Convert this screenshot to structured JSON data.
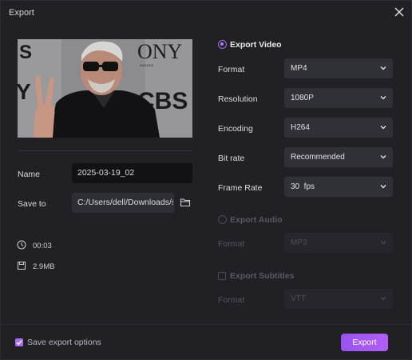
{
  "window": {
    "title": "Export"
  },
  "left": {
    "name_label": "Name",
    "name_value": "2025-03-19_02",
    "save_label": "Save to",
    "save_value": "C:/Users/dell/Downloads/sub",
    "duration": "00:03",
    "size": "2.9MB",
    "thumbnail_text": {
      "top_left": "S",
      "top_right": "ONY",
      "awards": "AWARDS",
      "right": "CBS",
      "left": "Y"
    }
  },
  "video": {
    "title": "Export Video",
    "selected": true,
    "rows": [
      {
        "label": "Format",
        "value": "MP4"
      },
      {
        "label": "Resolution",
        "value": "1080P"
      },
      {
        "label": "Encoding",
        "value": "H264"
      },
      {
        "label": "Bit rate",
        "value": "Recommended"
      },
      {
        "label": "Frame Rate",
        "value": "30  fps"
      }
    ]
  },
  "audio": {
    "title": "Export Audio",
    "selected": false,
    "format_label": "Format",
    "format_value": "MP3"
  },
  "subtitles": {
    "title": "Export Subtitles",
    "checked": false,
    "format_label": "Format",
    "format_value": "VTT"
  },
  "footer": {
    "save_options_label": "Save export options",
    "save_options_checked": true,
    "export_button": "Export"
  },
  "colors": {
    "accent": "#a86cf2",
    "background": "#202025",
    "field": "#303037"
  }
}
